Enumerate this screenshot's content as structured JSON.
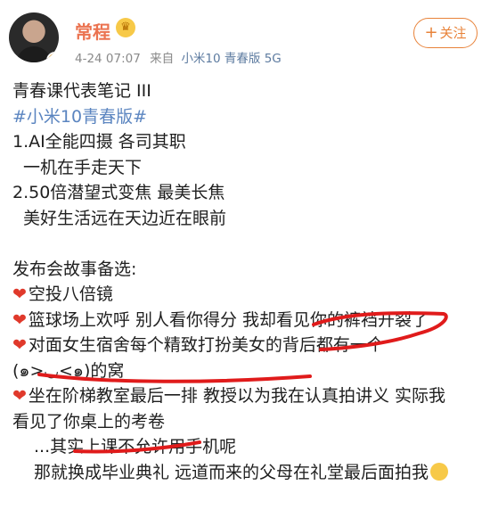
{
  "post": {
    "author": {
      "name": "常程",
      "verified_icon": "crown-icon",
      "avatar_badge_icon": "verified-v-icon"
    },
    "meta": {
      "time": "4-24 07:07",
      "source_prefix": "来自",
      "device": "小米10 青春版 5G"
    },
    "follow_label": "关注",
    "lines": [
      "青春课代表笔记 III",
      "#小米10青春版#",
      "1.AI全能四摄 各司其职",
      "一机在手走天下",
      "2.50倍潜望式变焦 最美长焦",
      "美好生活远在天边近在眼前",
      "",
      "发布会故事备选:",
      "空投八倍镜",
      "篮球场上欢呼 别人看你得分 我却看见你的裤裆开裂了",
      "对面女生宿舍每个精致打扮美女的背后都有一个",
      "(๑>◡<๑)的窝",
      "坐在阶梯教室最后一排 教授以为我在认真拍讲义 实际我",
      "看见了你桌上的考卷",
      "...其实上课不允许用手机呢",
      "那就换成毕业典礼 远道而来的父母在礼堂最后面拍我"
    ],
    "heart_icon": "heart-icon",
    "colors": {
      "username": "#eb7350",
      "hashtag": "#5b85c0",
      "follow_accent": "#e8833a",
      "annotation": "#e01b1b"
    }
  }
}
